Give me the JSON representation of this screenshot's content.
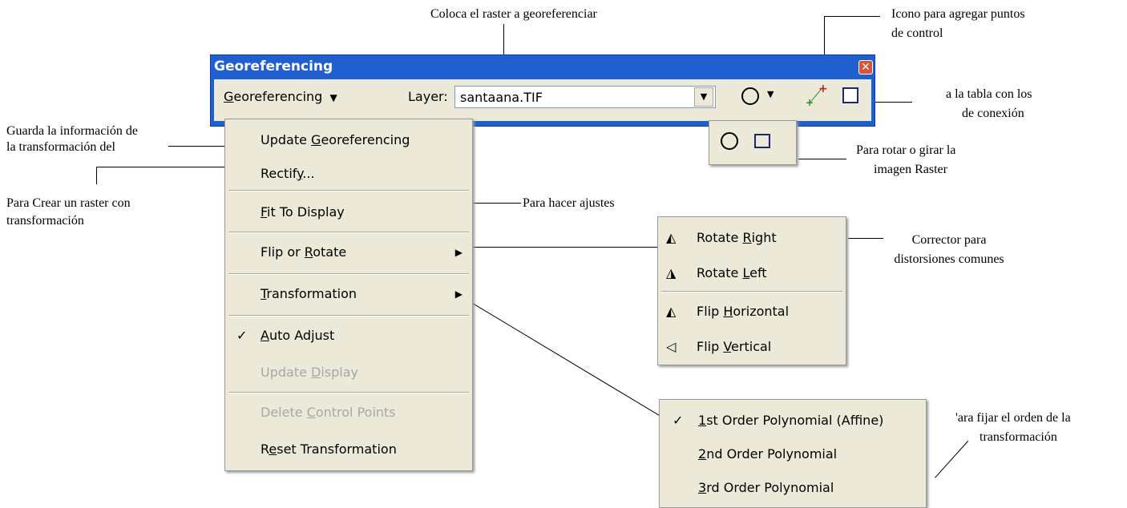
{
  "annotations": {
    "top_center": "Coloca el  raster a georeferenciar",
    "control_points_1": "Icono para agregar puntos",
    "control_points_2": "de control",
    "table_1": "a la  tabla con los",
    "table_2": "de conexión",
    "update_1": "Guarda la información de",
    "update_2": "la transformación del",
    "rectify_1": "Para Crear un raster con",
    "rectify_2": "transformación",
    "fit": "Para hacer ajustes",
    "rotate_1": "Para rotar o girar la",
    "rotate_2": "imagen Raster",
    "corrector_1": "Corrector para",
    "corrector_2": "distorsiones comunes",
    "order_1": "'ara fijar el orden de la",
    "order_2": "transformación"
  },
  "toolbar": {
    "title": "Georeferencing",
    "menu_first": "G",
    "menu_rest": "eoreferencing",
    "dropdown_glyph": "▼",
    "layer_label": "Layer:",
    "layer_value": "santaana.TIF",
    "close_glyph": "✕"
  },
  "menu": {
    "update": {
      "pre": "Update ",
      "u": "G",
      "post": "eoreferencing"
    },
    "rectify": {
      "pre": "Rectif",
      "u": "y",
      "post": "..."
    },
    "fit": {
      "pre": "",
      "u": "F",
      "post": "it To Display"
    },
    "flip": {
      "pre": "Flip or ",
      "u": "R",
      "post": "otate"
    },
    "transformation": {
      "pre": "",
      "u": "T",
      "post": "ransformation"
    },
    "auto": {
      "pre": "",
      "u": "A",
      "post": "uto Adjust"
    },
    "update_display": {
      "pre": "Update ",
      "u": "D",
      "post": "isplay"
    },
    "delete": {
      "pre": "Delete ",
      "u": "C",
      "post": "ontrol Points"
    },
    "reset": {
      "pre": "R",
      "u": "e",
      "post": "set Transformation"
    },
    "check": "✓",
    "arrow": "▶"
  },
  "flip_menu": {
    "rotate_right": {
      "pre": "Rotate ",
      "u": "R",
      "post": "ight"
    },
    "rotate_left": {
      "pre": "Rotate ",
      "u": "L",
      "post": "eft"
    },
    "flip_h": {
      "pre": "Flip ",
      "u": "H",
      "post": "orizontal"
    },
    "flip_v": {
      "pre": "Flip ",
      "u": "V",
      "post": "ertical"
    }
  },
  "trans_menu": {
    "first": {
      "pre": "",
      "u": "1",
      "post": "st Order Polynomial (Affine)"
    },
    "second": {
      "pre": "",
      "u": "2",
      "post": "nd Order Polynomial"
    },
    "third": {
      "pre": "",
      "u": "3",
      "post": "rd Order Polynomial"
    }
  }
}
